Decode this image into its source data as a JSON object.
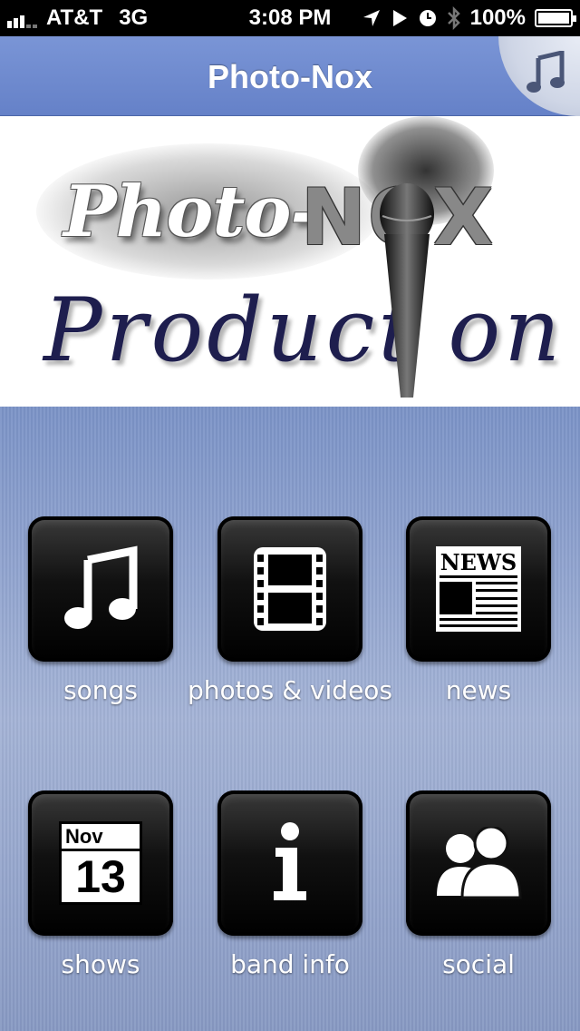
{
  "status_bar": {
    "carrier": "AT&T",
    "network": "3G",
    "time": "3:08 PM",
    "battery": "100%"
  },
  "nav": {
    "title": "Photo-Nox"
  },
  "banner": {
    "logo_line1": "Photo-",
    "logo_line1b": "NOX",
    "logo_line2": "Product on"
  },
  "tiles": [
    {
      "label": "songs",
      "icon": "music-note-icon"
    },
    {
      "label": "photos & videos",
      "icon": "film-strip-icon"
    },
    {
      "label": "news",
      "icon": "newspaper-icon"
    },
    {
      "label": "shows",
      "icon": "calendar-icon"
    },
    {
      "label": "band info",
      "icon": "info-icon"
    },
    {
      "label": "social",
      "icon": "people-icon"
    }
  ],
  "news_icon": {
    "headline": "NEWS"
  },
  "calendar": {
    "month": "Nov",
    "day": "13"
  }
}
